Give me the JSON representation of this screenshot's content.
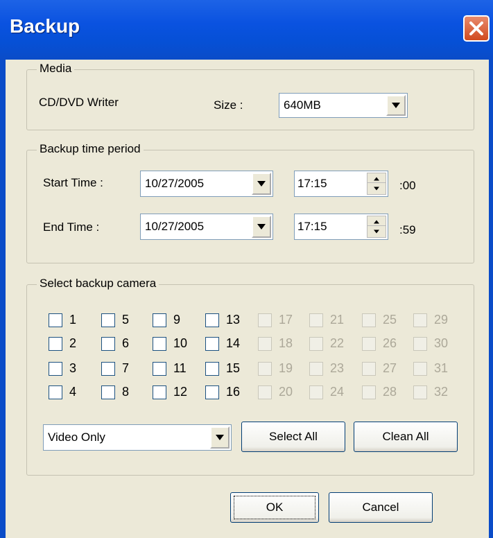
{
  "window": {
    "title": "Backup"
  },
  "media": {
    "group_label": "Media",
    "device": "CD/DVD Writer",
    "size_label": "Size :",
    "size_value": "640MB"
  },
  "period": {
    "group_label": "Backup time period",
    "start_label": "Start Time :",
    "start_date": "10/27/2005",
    "start_time": "17:15",
    "start_seconds": ":00",
    "end_label": "End Time :",
    "end_date": "10/27/2005",
    "end_time": "17:15",
    "end_seconds": ":59"
  },
  "cameras": {
    "group_label": "Select backup camera",
    "enabled": [
      "1",
      "2",
      "3",
      "4",
      "5",
      "6",
      "7",
      "8",
      "9",
      "10",
      "11",
      "12",
      "13",
      "14",
      "15",
      "16"
    ],
    "disabled": [
      "17",
      "18",
      "19",
      "20",
      "21",
      "22",
      "23",
      "24",
      "25",
      "26",
      "27",
      "28",
      "29",
      "30",
      "31",
      "32"
    ],
    "mode_value": "Video Only",
    "select_all": "Select All",
    "clean_all": "Clean All"
  },
  "buttons": {
    "ok": "OK",
    "cancel": "Cancel"
  },
  "colors": {
    "titlebar": "#0a52e0",
    "dialog_bg": "#ece9d8",
    "close": "#d14a1f"
  }
}
